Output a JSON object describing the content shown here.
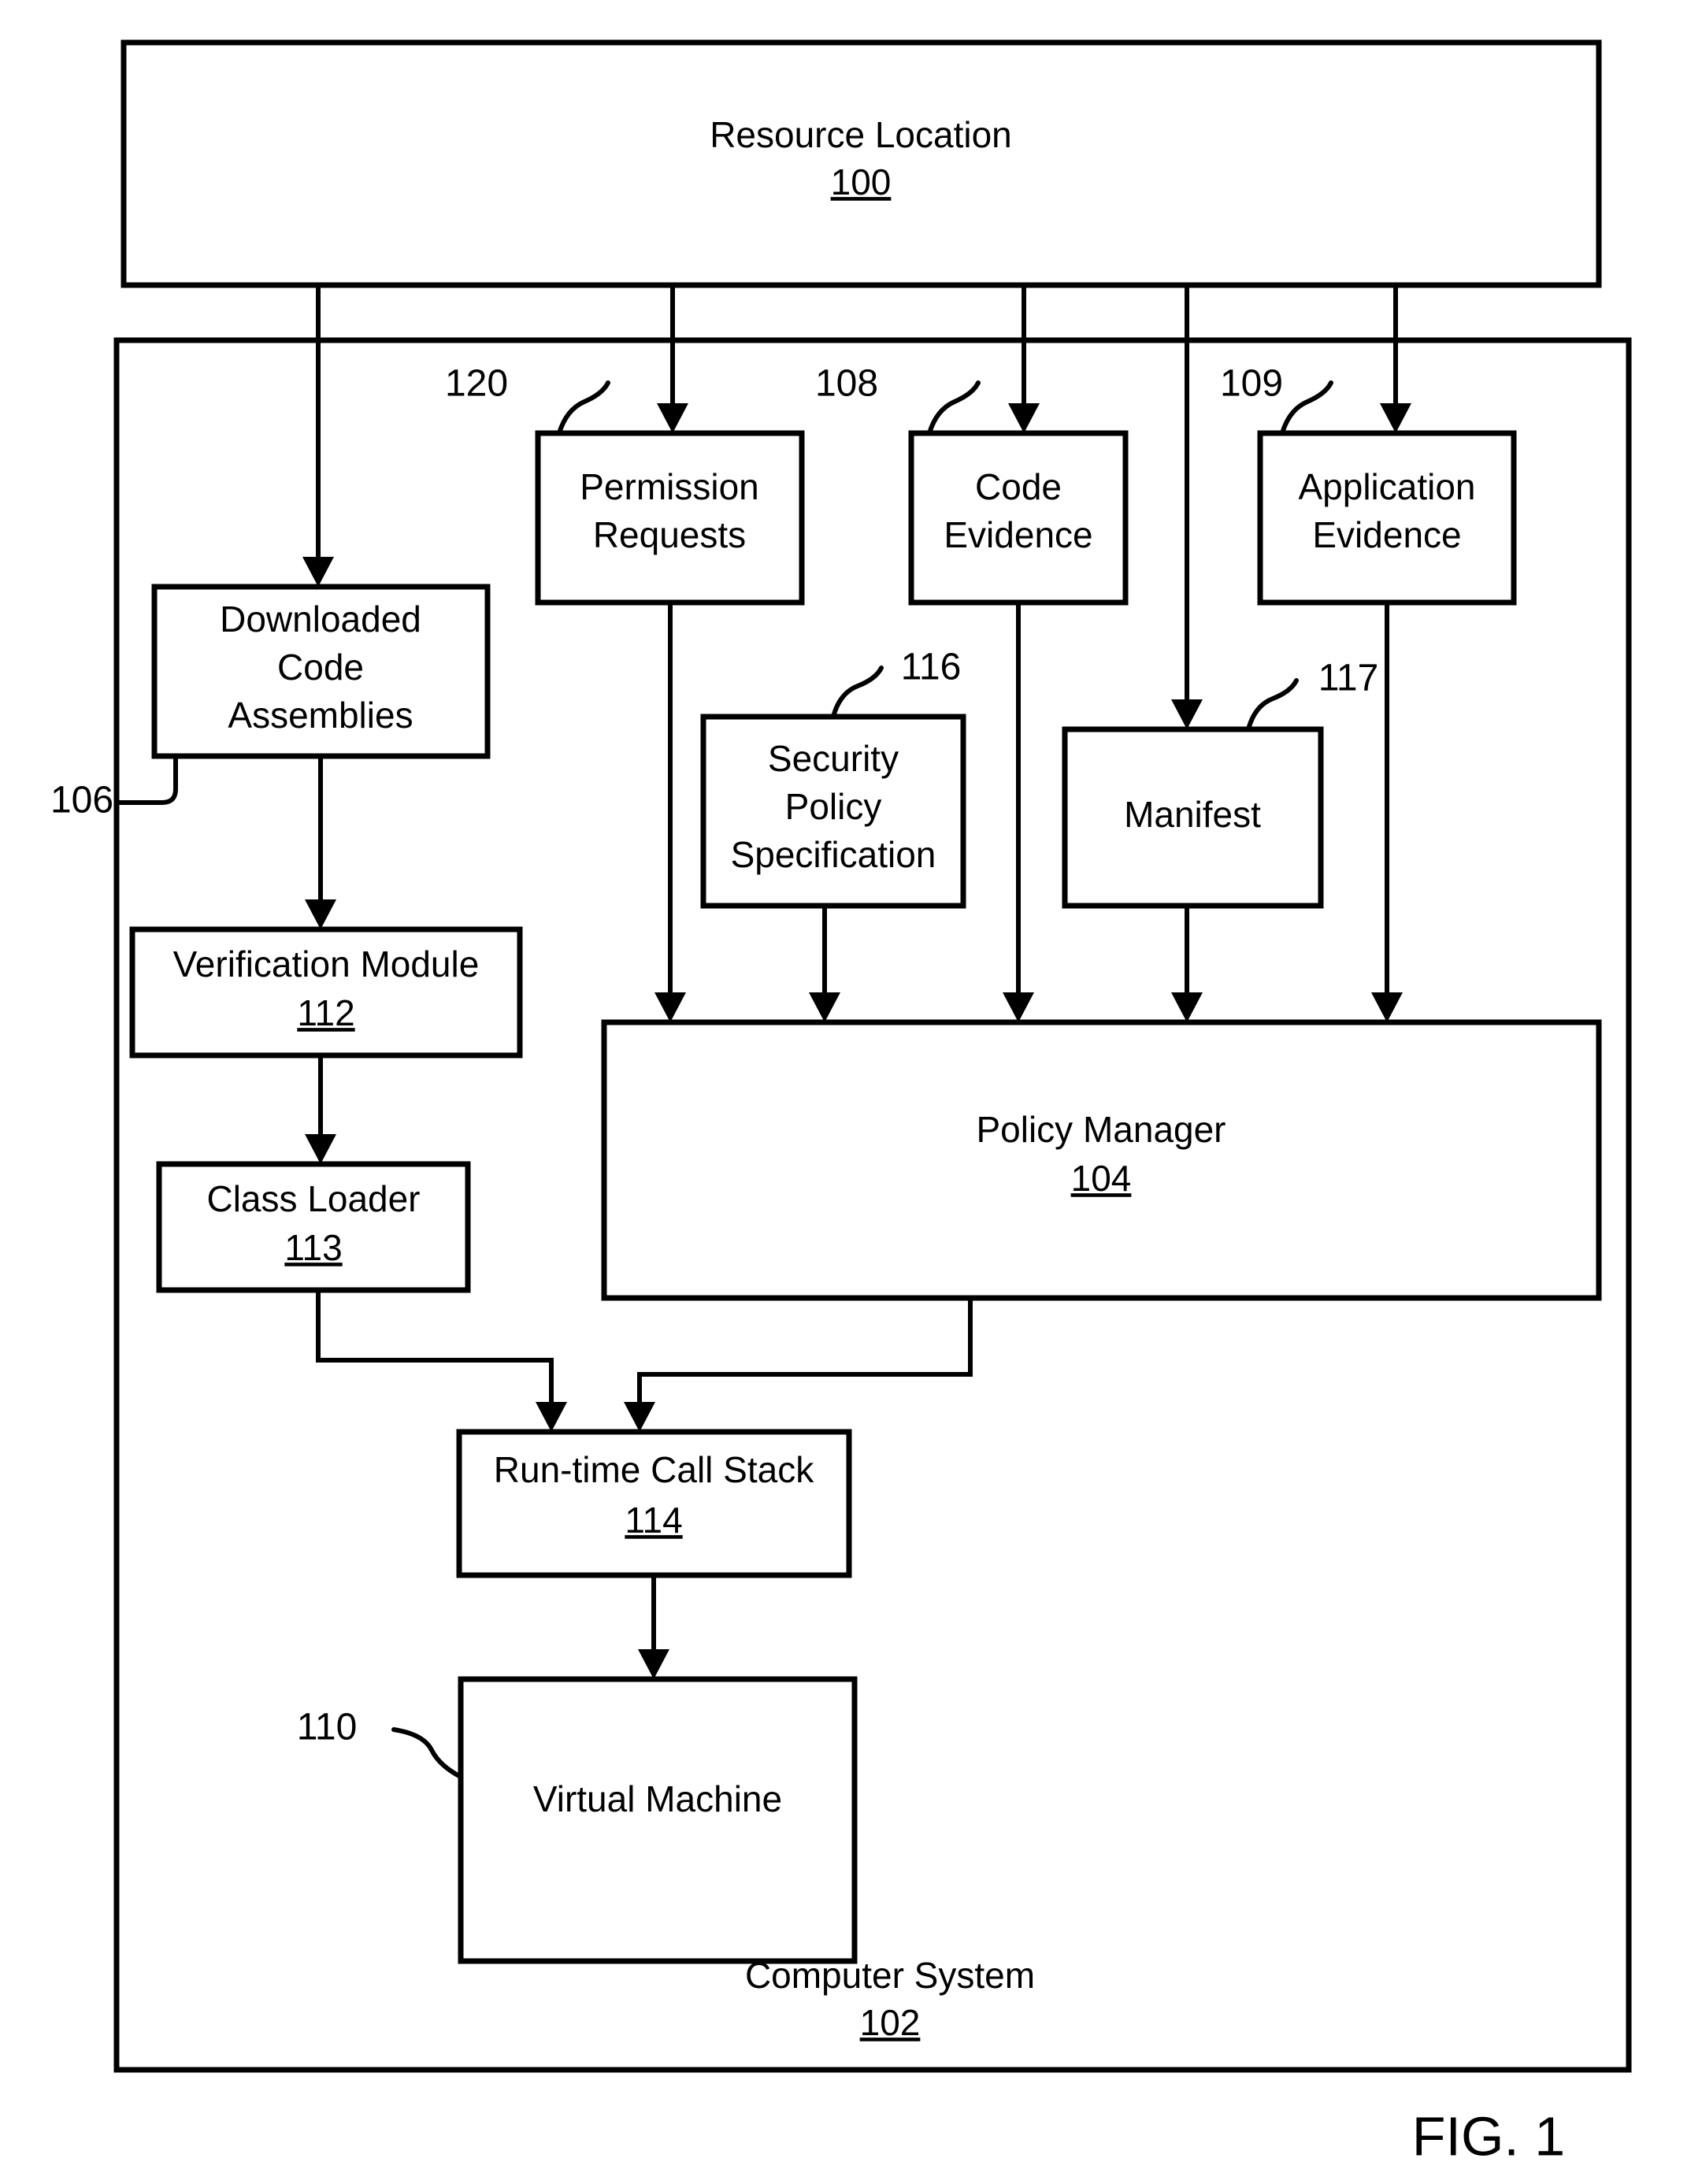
{
  "figure": {
    "caption": "FIG. 1",
    "title_box": {
      "label": "Resource Location",
      "number": "100"
    },
    "container_box": {
      "label": "Computer System",
      "number": "102"
    },
    "boxes": [
      {
        "id": "downloaded_code_assemblies",
        "line1": "Downloaded",
        "line2": "Code",
        "line3": "Assemblies",
        "number": ""
      },
      {
        "id": "permission_requests",
        "line1": "Permission",
        "line2": "Requests",
        "line3": "",
        "number": ""
      },
      {
        "id": "code_evidence",
        "line1": "Code",
        "line2": "Evidence",
        "line3": "",
        "number": ""
      },
      {
        "id": "application_evidence",
        "line1": "Application",
        "line2": "Evidence",
        "line3": "",
        "number": ""
      },
      {
        "id": "security_policy_specification",
        "line1": "Security",
        "line2": "Policy",
        "line3": "Specification",
        "number": ""
      },
      {
        "id": "manifest",
        "line1": "Manifest",
        "line2": "",
        "line3": "",
        "number": ""
      },
      {
        "id": "verification_module",
        "line1": "Verification Module",
        "line2": "",
        "line3": "",
        "number": "112"
      },
      {
        "id": "class_loader",
        "line1": "Class Loader",
        "line2": "",
        "line3": "",
        "number": "113"
      },
      {
        "id": "policy_manager",
        "line1": "Policy Manager",
        "line2": "",
        "line3": "",
        "number": "104"
      },
      {
        "id": "runtime_call_stack",
        "line1": "Run-time Call Stack",
        "line2": "",
        "line3": "",
        "number": "114"
      },
      {
        "id": "virtual_machine",
        "line1": "Virtual Machine",
        "line2": "",
        "line3": "",
        "number": ""
      }
    ],
    "reference_numerals": [
      {
        "id": "ref-106",
        "value": "106"
      },
      {
        "id": "ref-120",
        "value": "120"
      },
      {
        "id": "ref-108",
        "value": "108"
      },
      {
        "id": "ref-109",
        "value": "109"
      },
      {
        "id": "ref-116",
        "value": "116"
      },
      {
        "id": "ref-117",
        "value": "117"
      },
      {
        "id": "ref-110",
        "value": "110"
      }
    ]
  }
}
